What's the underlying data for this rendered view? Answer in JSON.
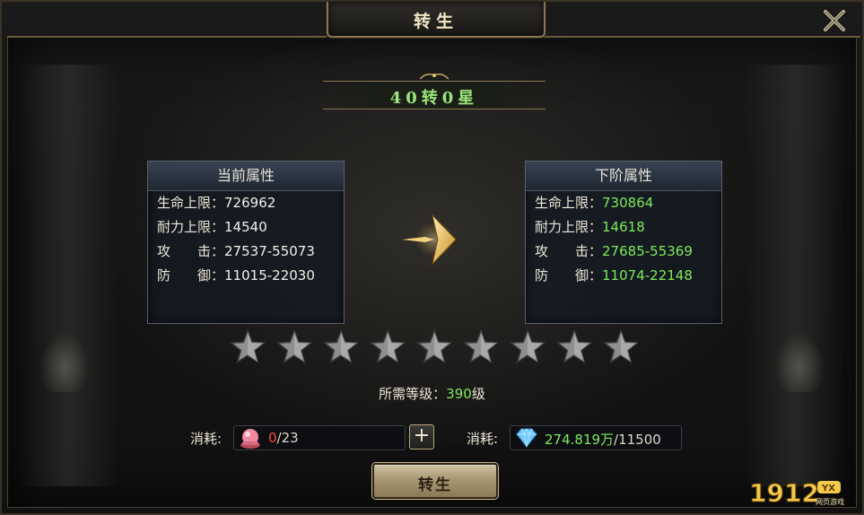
{
  "window": {
    "title": "转生"
  },
  "rebirth_level": "40转0星",
  "current_panel": {
    "header": "当前属性",
    "stats": [
      {
        "label": "生命上限：",
        "value": "726962"
      },
      {
        "label": "耐力上限：",
        "value": "14540"
      },
      {
        "label": "攻　　击：",
        "value": "27537-55073"
      },
      {
        "label": "防　　御：",
        "value": "11015-22030"
      }
    ]
  },
  "next_panel": {
    "header": "下阶属性",
    "stats": [
      {
        "label": "生命上限：",
        "value": "730864"
      },
      {
        "label": "耐力上限：",
        "value": "14618"
      },
      {
        "label": "攻　　击：",
        "value": "27685-55369"
      },
      {
        "label": "防　　御：",
        "value": "11074-22148"
      }
    ]
  },
  "stars": {
    "total": 9,
    "filled": 0
  },
  "requirement": {
    "label": "所需等级：",
    "value": "390",
    "unit": "级"
  },
  "cost_item": {
    "label": "消耗:",
    "current": "0",
    "required": "/23",
    "icon": "pink-orb-icon"
  },
  "cost_currency": {
    "label": "消耗:",
    "current": "274.819万",
    "required": "/11500",
    "icon": "diamond-icon"
  },
  "plus_label": "+",
  "rebirth_button": "转生",
  "watermark": {
    "main": "1912",
    "badge": "YX",
    "sub": "网页游戏"
  },
  "colors": {
    "accent_green": "#7dea5a",
    "warning_red": "#ff4a3a",
    "gold_border": "#8a7650"
  }
}
